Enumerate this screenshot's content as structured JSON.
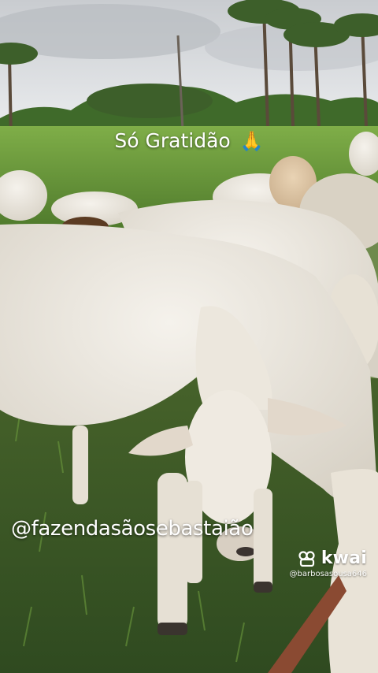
{
  "overlay": {
    "caption": "Só Gratidão",
    "caption_emoji": "🙏",
    "handle": "@fazendasãosebastaião"
  },
  "watermark": {
    "brand": "kwai",
    "username": "@barbosasousa646",
    "icon": "kwai-logo-icon"
  },
  "scene": {
    "subject": "white-cattle",
    "colors": {
      "sky": "#d7dadd",
      "grass": "#5f8b35",
      "cattle": "#ece7dd",
      "caption_text": "#ffffff"
    }
  }
}
